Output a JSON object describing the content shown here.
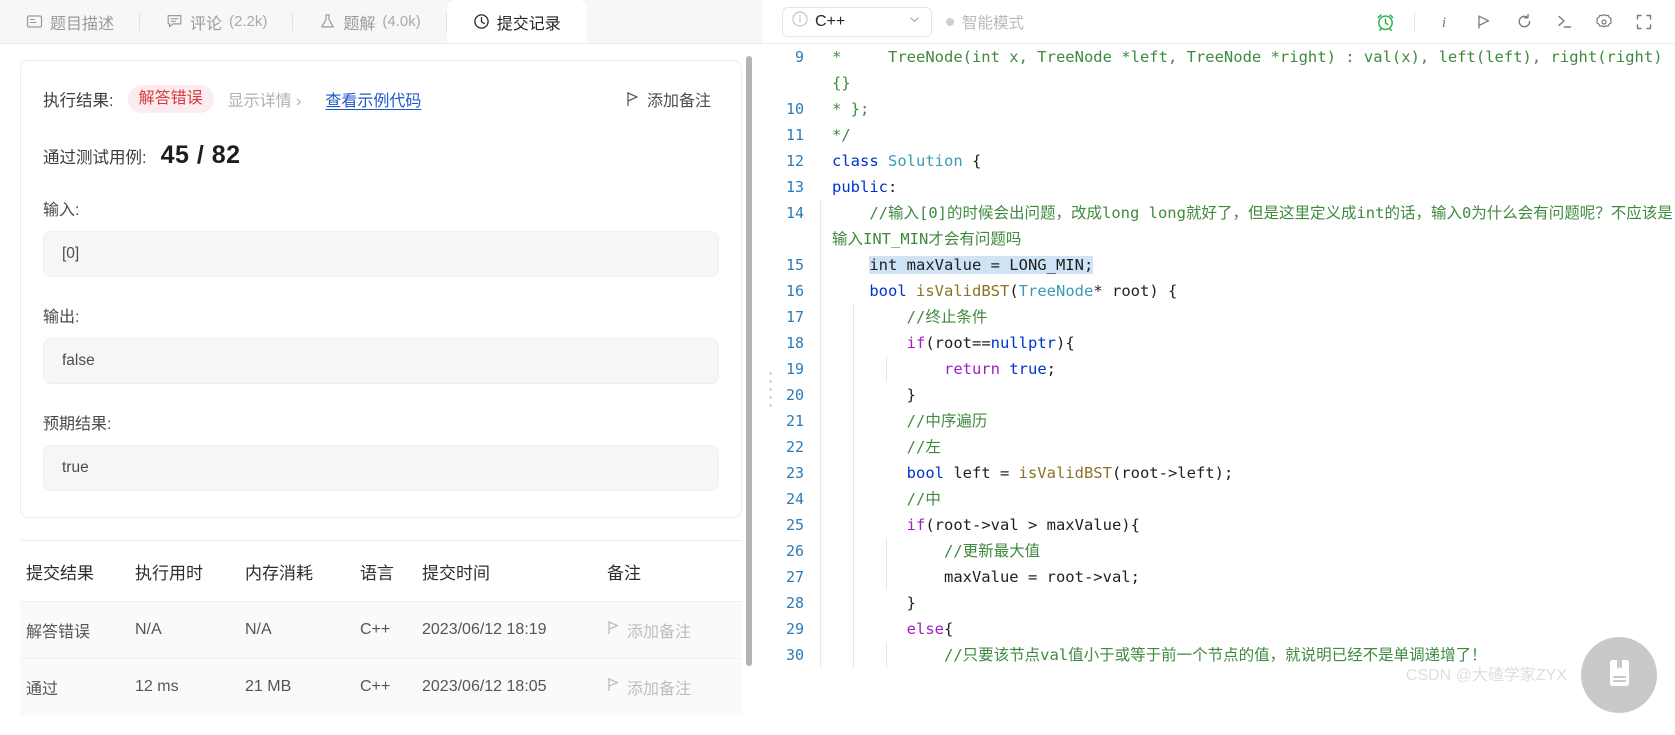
{
  "tabs": [
    {
      "label": "题目描述",
      "icon": "description-icon",
      "count": "",
      "active": false
    },
    {
      "label": "评论",
      "icon": "comment-icon",
      "count": "(2.2k)",
      "active": false
    },
    {
      "label": "题解",
      "icon": "flask-icon",
      "count": "(4.0k)",
      "active": false
    },
    {
      "label": "提交记录",
      "icon": "clock-icon",
      "count": "",
      "active": true
    }
  ],
  "result": {
    "exec_label": "执行结果:",
    "status": "解答错误",
    "detail_link": "显示详情 ›",
    "sample_code_link": "查看示例代码",
    "add_note": "添加备注",
    "passed_label": "通过测试用例:",
    "passed_count": "45 / 82",
    "input_label": "输入:",
    "input_value": "[0]",
    "output_label": "输出:",
    "output_value": "false",
    "expected_label": "预期结果:",
    "expected_value": "true"
  },
  "submissions": {
    "headers": [
      "提交结果",
      "执行用时",
      "内存消耗",
      "语言",
      "提交时间",
      "备注"
    ],
    "rows": [
      {
        "result": "解答错误",
        "result_state": "wrong",
        "runtime": "N/A",
        "memory": "N/A",
        "language": "C++",
        "time": "2023/06/12 18:19",
        "note": "添加备注"
      },
      {
        "result": "通过",
        "result_state": "pass",
        "runtime": "12 ms",
        "memory": "21 MB",
        "language": "C++",
        "time": "2023/06/12 18:05",
        "note": "添加备注"
      }
    ]
  },
  "ide": {
    "language": "C++",
    "smart_mode": "智能模式",
    "toolbar_icons": [
      "alarm-clock-icon",
      "info-icon",
      "run-icon",
      "reset-icon",
      "console-icon",
      "settings-icon",
      "fullscreen-icon"
    ],
    "accent_green": "#22b14c",
    "watermark": "CSDN @大碴学家ZYX"
  },
  "code": {
    "lines": [
      {
        "no": "9",
        "segs": [
          {
            "t": "*     TreeNode(int x, TreeNode *left, TreeNode *right) : val(x), left(left), right(right) {}",
            "c": "cmt"
          }
        ],
        "indent": 0,
        "wrap": true
      },
      {
        "no": "10",
        "segs": [
          {
            "t": "* };",
            "c": "cmt"
          }
        ],
        "indent": 0
      },
      {
        "no": "11",
        "segs": [
          {
            "t": "*/",
            "c": "cmt"
          }
        ],
        "indent": 0
      },
      {
        "no": "12",
        "segs": [
          {
            "t": "class",
            "c": "kw"
          },
          {
            "t": " ",
            "c": ""
          },
          {
            "t": "Solution",
            "c": "typ"
          },
          {
            "t": " {",
            "c": ""
          }
        ],
        "indent": 0
      },
      {
        "no": "13",
        "segs": [
          {
            "t": "public",
            "c": "kw"
          },
          {
            "t": ":",
            "c": ""
          }
        ],
        "indent": 0
      },
      {
        "no": "14",
        "segs": [
          {
            "t": "    //输入[0]的时候会出问题，改成long long就好了，但是这里定义成int的话，输入0为什么会有问题呢？不应该是输入INT_MIN才会有问题吗",
            "c": "cmt"
          }
        ],
        "indent": 1,
        "wrap": true
      },
      {
        "no": "15",
        "segs": [
          {
            "t": "    ",
            "c": ""
          },
          {
            "t": "int maxValue = LONG_MIN;",
            "c": "sel-line"
          }
        ],
        "indent": 1
      },
      {
        "no": "16",
        "segs": [
          {
            "t": "    ",
            "c": ""
          },
          {
            "t": "bool",
            "c": "kw"
          },
          {
            "t": " ",
            "c": ""
          },
          {
            "t": "isValidBST",
            "c": "fn"
          },
          {
            "t": "(",
            "c": ""
          },
          {
            "t": "TreeNode",
            "c": "typ"
          },
          {
            "t": "* root) {",
            "c": ""
          }
        ],
        "indent": 1
      },
      {
        "no": "17",
        "segs": [
          {
            "t": "        //终止条件",
            "c": "cmt"
          }
        ],
        "indent": 2
      },
      {
        "no": "18",
        "segs": [
          {
            "t": "        ",
            "c": ""
          },
          {
            "t": "if",
            "c": "kw2"
          },
          {
            "t": "(root==",
            "c": ""
          },
          {
            "t": "nullptr",
            "c": "kw"
          },
          {
            "t": "){",
            "c": ""
          }
        ],
        "indent": 2
      },
      {
        "no": "19",
        "segs": [
          {
            "t": "            ",
            "c": ""
          },
          {
            "t": "return",
            "c": "kw2"
          },
          {
            "t": " ",
            "c": ""
          },
          {
            "t": "true",
            "c": "kw"
          },
          {
            "t": ";",
            "c": ""
          }
        ],
        "indent": 3
      },
      {
        "no": "20",
        "segs": [
          {
            "t": "        }",
            "c": ""
          }
        ],
        "indent": 2
      },
      {
        "no": "21",
        "segs": [
          {
            "t": "        //中序遍历",
            "c": "cmt"
          }
        ],
        "indent": 2
      },
      {
        "no": "22",
        "segs": [
          {
            "t": "        //左",
            "c": "cmt"
          }
        ],
        "indent": 2
      },
      {
        "no": "23",
        "segs": [
          {
            "t": "        ",
            "c": ""
          },
          {
            "t": "bool",
            "c": "kw"
          },
          {
            "t": " left = ",
            "c": ""
          },
          {
            "t": "isValidBST",
            "c": "fn"
          },
          {
            "t": "(root->left);",
            "c": ""
          }
        ],
        "indent": 2
      },
      {
        "no": "24",
        "segs": [
          {
            "t": "        //中",
            "c": "cmt"
          }
        ],
        "indent": 2
      },
      {
        "no": "25",
        "segs": [
          {
            "t": "        ",
            "c": ""
          },
          {
            "t": "if",
            "c": "kw2"
          },
          {
            "t": "(root->val > maxValue){",
            "c": ""
          }
        ],
        "indent": 2
      },
      {
        "no": "26",
        "segs": [
          {
            "t": "            //更新最大值",
            "c": "cmt"
          }
        ],
        "indent": 3
      },
      {
        "no": "27",
        "segs": [
          {
            "t": "            maxValue = root->val;",
            "c": ""
          }
        ],
        "indent": 3
      },
      {
        "no": "28",
        "segs": [
          {
            "t": "        }",
            "c": ""
          }
        ],
        "indent": 2
      },
      {
        "no": "29",
        "segs": [
          {
            "t": "        ",
            "c": ""
          },
          {
            "t": "else",
            "c": "kw2"
          },
          {
            "t": "{",
            "c": ""
          }
        ],
        "indent": 2
      },
      {
        "no": "30",
        "segs": [
          {
            "t": "            //只要该节点val值小于或等于前一个节点的值，就说明已经不是单调递增了！",
            "c": "cmt"
          }
        ],
        "indent": 3,
        "wrap": true
      }
    ]
  }
}
